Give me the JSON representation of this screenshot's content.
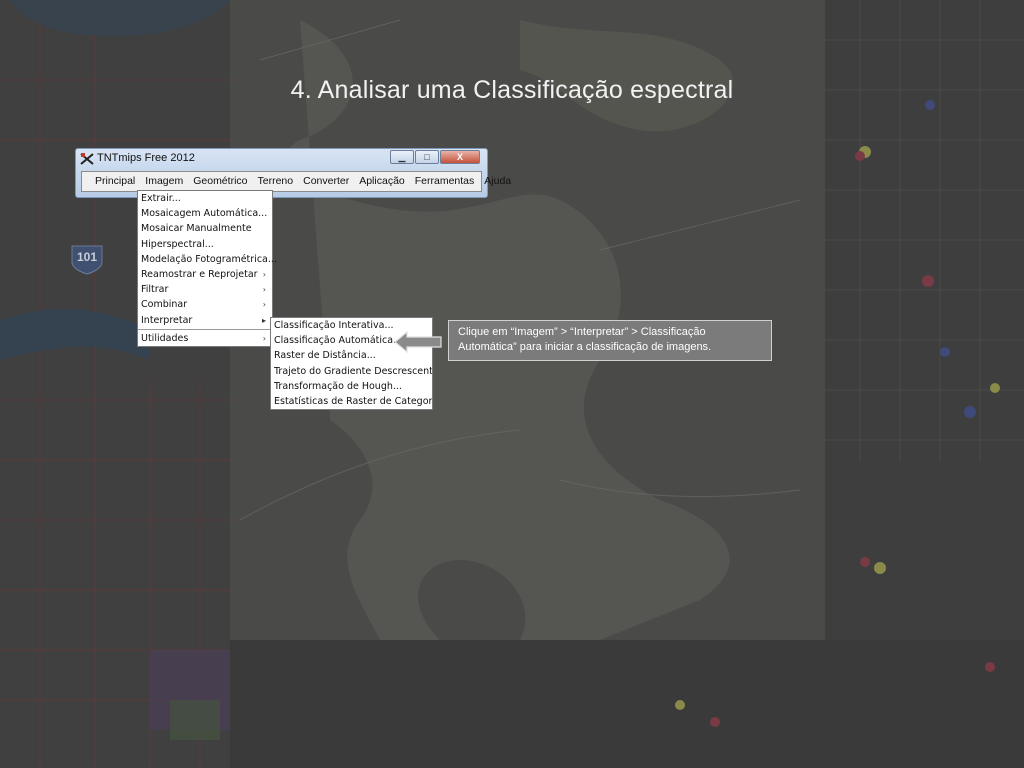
{
  "slide": {
    "title": "4. Analisar uma Classificação espectral"
  },
  "window": {
    "title": "TNTmips Free 2012",
    "minimize_glyph": "▁",
    "maximize_glyph": "□",
    "close_glyph": "X",
    "menubar": [
      "Principal",
      "Imagem",
      "Geométrico",
      "Terreno",
      "Converter",
      "Aplicação",
      "Ferramentas",
      "Ajuda"
    ]
  },
  "imagem_menu": {
    "items": [
      {
        "label": "Extrair...",
        "submenu": false
      },
      {
        "label": "Mosaicagem Automática...",
        "submenu": false
      },
      {
        "label": "Mosaicar Manualmente",
        "submenu": false
      },
      {
        "label": "Hiperspectral...",
        "submenu": false
      },
      {
        "label": "Modelação Fotogramétrica...",
        "submenu": false
      },
      {
        "label": "Reamostrar e Reprojetar",
        "submenu": true
      },
      {
        "label": "Filtrar",
        "submenu": true
      },
      {
        "label": "Combinar",
        "submenu": true
      },
      {
        "label": "Interpretar",
        "submenu": true
      },
      {
        "label": "Utilidades",
        "submenu": true
      }
    ]
  },
  "interpretar_submenu": {
    "items": [
      "Classificação Interativa...",
      "Classificação Automática...",
      "Raster de Distância...",
      "Trajeto do Gradiente Descrescente...",
      "Transformação de Hough...",
      "Estatísticas de Raster de Categoria..."
    ]
  },
  "callout": {
    "line1": "Clique em “Imagem” > “Interpretar” > Classificação",
    "line2": "Automática” para iniciar a classificação de imagens."
  },
  "map": {
    "road_badge": "101"
  },
  "colors": {
    "slide_background": "#3b3b3b",
    "title_text": "#f2f2f2",
    "callout_fill": "#7b7b7b",
    "arrow_fill": "#8a8a8a"
  }
}
